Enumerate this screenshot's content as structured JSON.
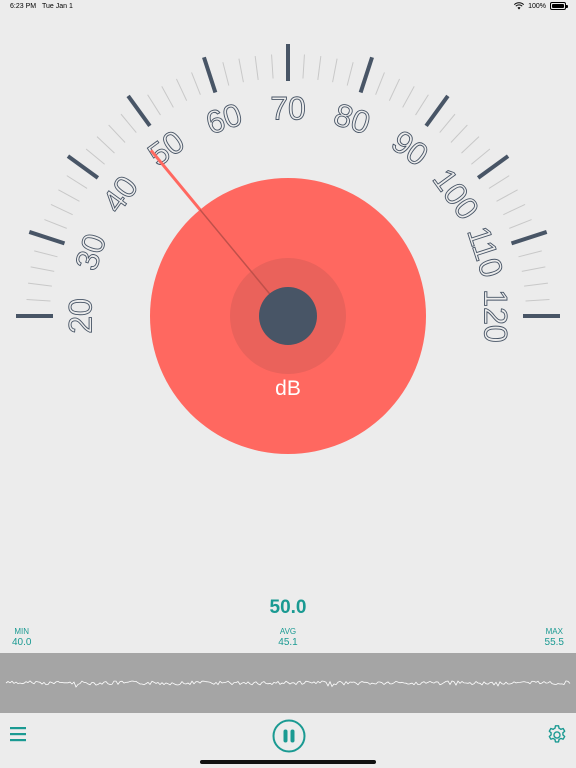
{
  "status_bar": {
    "time": "6:23 PM",
    "date": "Tue Jan 1",
    "battery": "100%",
    "battery_level": 1.0
  },
  "gauge": {
    "min_scale": 20,
    "max_scale": 120,
    "labels": [
      "20",
      "30",
      "40",
      "50",
      "60",
      "70",
      "80",
      "90",
      "100",
      "110",
      "120"
    ],
    "unit": "dB",
    "needle_value": 48,
    "colors": {
      "disc": "#ff6860",
      "hub_ring": "#ea625b",
      "hub": "#485566",
      "ticks": "#485566",
      "minor_ticks": "#c8c8c8",
      "needle": "#ff6860"
    }
  },
  "reading": {
    "current": "50.0"
  },
  "stats": {
    "min_label": "MIN",
    "min_value": "40.0",
    "avg_label": "AVG",
    "avg_value": "45.1",
    "max_label": "MAX",
    "max_value": "55.5"
  },
  "accent_color": "#1a9a92",
  "icons": {
    "menu": "hamburger-icon",
    "pause": "pause-icon",
    "settings": "gear-icon",
    "wifi": "wifi-icon",
    "battery": "battery-icon"
  }
}
